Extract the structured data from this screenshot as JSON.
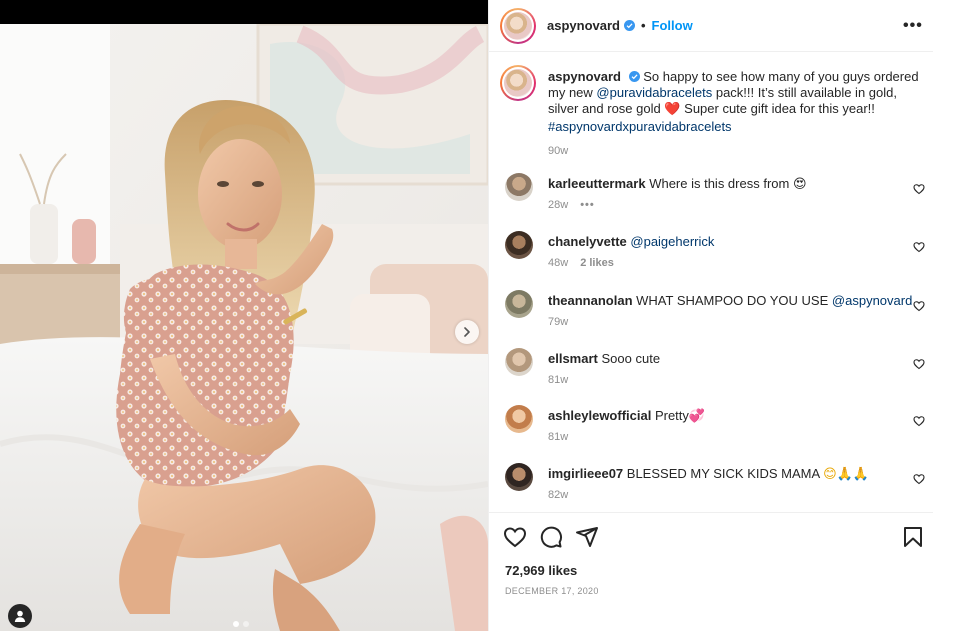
{
  "post": {
    "username": "aspynovard",
    "verified": true,
    "separator": "•",
    "follow_label": "Follow",
    "more_label": "•••"
  },
  "caption": {
    "username": "aspynovard",
    "text_1": "So happy to see how many of you guys ordered my new ",
    "mention": "@puravidabracelets",
    "text_2": " pack!!! It’s still available in gold, silver and rose gold ",
    "emoji": "❤️",
    "text_3": " Super cute gift idea for this year!! ",
    "hashtag": "#aspynovardxpuravidabracelets",
    "time": "90w"
  },
  "comments": [
    {
      "username": "karleeuttermark",
      "text": "Where is this dress from",
      "emoji": "😍",
      "mention": "",
      "time": "28w",
      "likes": "",
      "extra": "•••"
    },
    {
      "username": "chanelyvette",
      "text": "",
      "emoji": "",
      "mention": "@paigeherrick",
      "time": "48w",
      "likes": "2 likes",
      "extra": ""
    },
    {
      "username": "theannanolan",
      "text": "WHAT SHAMPOO DO YOU USE",
      "emoji": "",
      "mention": "@aspynovard",
      "time": "79w",
      "likes": "",
      "extra": ""
    },
    {
      "username": "ellsmart",
      "text": "Sooo cute",
      "emoji": "",
      "mention": "",
      "time": "81w",
      "likes": "",
      "extra": ""
    },
    {
      "username": "ashleylewofficial",
      "text": "Pretty",
      "emoji": "💞",
      "mention": "",
      "time": "81w",
      "likes": "",
      "extra": ""
    },
    {
      "username": "imgirlieee07",
      "text": "BLESSED MY SICK KIDS MAMA",
      "emoji": "😊🙏🙏",
      "mention": "",
      "time": "82w",
      "likes": "",
      "extra": ""
    }
  ],
  "actions": {
    "icons": [
      "heart-icon",
      "comment-icon",
      "share-icon",
      "bookmark-icon"
    ],
    "likes_label": "72,969 likes",
    "date": "December 17, 2020"
  },
  "carousel": {
    "current_slide": 1,
    "total_slides": 2
  },
  "colors": {
    "link": "#00376b",
    "follow": "#0095f6",
    "muted": "#8e8e8e",
    "text": "#262626"
  }
}
